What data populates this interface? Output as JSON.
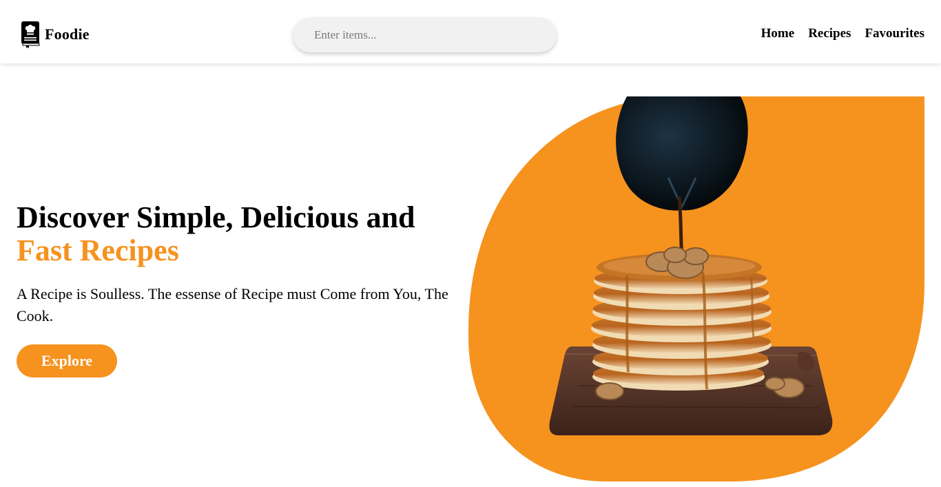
{
  "brand": {
    "name": "Foodie",
    "icon": "chef-book-icon"
  },
  "search": {
    "placeholder": "Enter items..."
  },
  "nav": {
    "items": [
      {
        "label": "Home"
      },
      {
        "label": "Recipes"
      },
      {
        "label": "Favourites"
      }
    ]
  },
  "hero": {
    "title_line1": "Discover Simple, Delicious and",
    "title_line2": "Fast Recipes",
    "subtitle": "A Recipe is Soulless. The essense of Recipe must Come from You, The Cook.",
    "cta_label": "Explore",
    "image": "pancake-stack-with-syrup"
  },
  "colors": {
    "accent": "#f6921e",
    "text": "#000000",
    "search_bg": "#f1f1f1"
  }
}
